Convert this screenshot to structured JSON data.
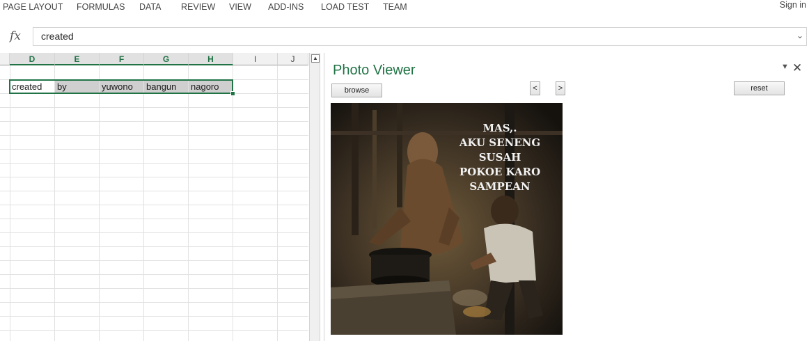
{
  "ribbon": {
    "tabs": [
      "PAGE LAYOUT",
      "FORMULAS",
      "DATA",
      "REVIEW",
      "VIEW",
      "ADD-INS",
      "LOAD TEST",
      "TEAM"
    ],
    "signin": "Sign in"
  },
  "formula_bar": {
    "fx_label": "fx",
    "value": "created"
  },
  "sheet": {
    "columns": [
      "D",
      "E",
      "F",
      "G",
      "H",
      "I",
      "J"
    ],
    "row_cells": [
      "created",
      "by",
      "yuwono",
      "bangun",
      "nagoro"
    ]
  },
  "photo_viewer": {
    "title": "Photo Viewer",
    "browse_label": "browse",
    "prev_label": "<",
    "next_label": ">",
    "reset_label": "reset",
    "photo_caption": [
      "MAS,.",
      "AKU SENENG",
      "SUSAH",
      "POKOE KARO",
      "SAMPEAN"
    ]
  }
}
